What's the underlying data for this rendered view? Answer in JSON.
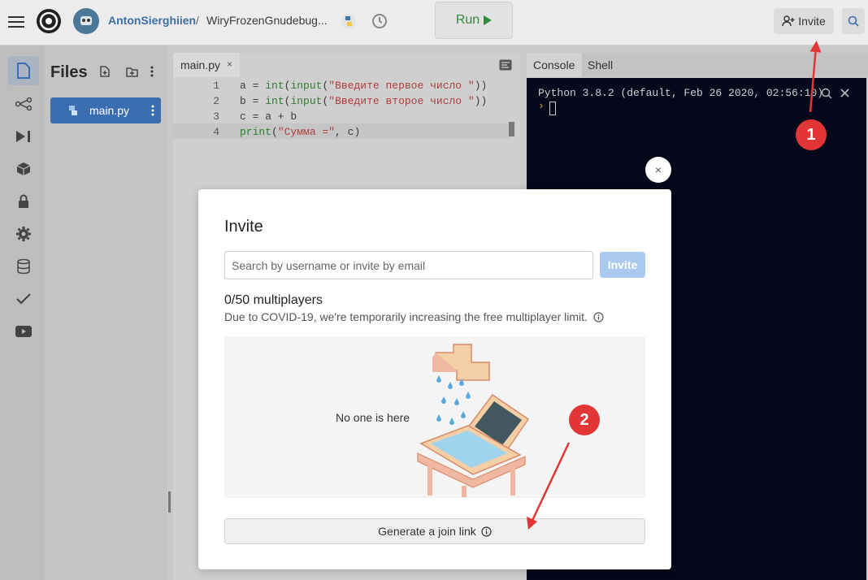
{
  "topbar": {
    "user": "AntonSierghiien",
    "separator": "/",
    "repl_name": "WiryFrozenGnudebug...",
    "run_label": "Run",
    "invite_label": "Invite"
  },
  "files": {
    "title": "Files",
    "items": [
      {
        "label": "main.py"
      }
    ]
  },
  "editor": {
    "tab": "main.py",
    "lines": [
      {
        "n": "1",
        "code": "a = int(input(\"Введите первое число \"))"
      },
      {
        "n": "2",
        "code": "b = int(input(\"Введите второе число \"))"
      },
      {
        "n": "3",
        "code": "c = a + b"
      },
      {
        "n": "4",
        "code": "print(\"Сумма =\", c)"
      }
    ]
  },
  "console": {
    "tabs": [
      "Console",
      "Shell"
    ],
    "header": "Python 3.8.2 (default, Feb 26 2020, 02:56:10)",
    "prompt": "›"
  },
  "modal": {
    "title": "Invite",
    "close": "×",
    "search_placeholder": "Search by username or invite by email",
    "invite_button": "Invite",
    "multiplayers": "0/50 multiplayers",
    "note": "Due to COVID-19, we're temporarily increasing the free multiplayer limit.",
    "empty_text": "No one is here",
    "join_link_button": "Generate a join link"
  },
  "annotations": {
    "badge1": "1",
    "badge2": "2",
    "color": "#e23636"
  },
  "colors": {
    "accent": "#3a6eb1",
    "run": "#2f8a3e",
    "console_bg": "#05081a"
  }
}
